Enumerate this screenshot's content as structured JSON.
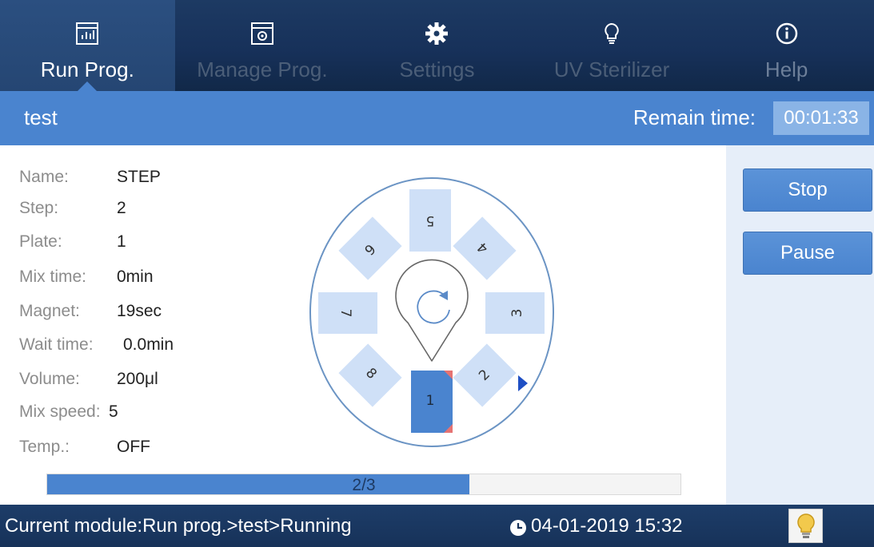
{
  "nav": {
    "tabs": [
      {
        "label": "Run Prog.",
        "icon": "chart-icon",
        "active": true
      },
      {
        "label": "Manage Prog.",
        "icon": "manage-icon",
        "active": false
      },
      {
        "label": "Settings",
        "icon": "gear-icon",
        "active": false
      },
      {
        "label": "UV Sterilizer",
        "icon": "bulb-icon",
        "active": false
      },
      {
        "label": "Help",
        "icon": "info-icon",
        "active": false
      }
    ]
  },
  "title_bar": {
    "program_name": "test",
    "remain_label": "Remain time:",
    "remain_value": "00:01:33"
  },
  "info": {
    "rows": [
      {
        "label": "Name:",
        "value": "STEP"
      },
      {
        "label": "Step:",
        "value": "2"
      },
      {
        "label": "Plate:",
        "value": "1"
      },
      {
        "label": "Mix time:",
        "value": "0min"
      },
      {
        "label": "Magnet:",
        "value": "19sec"
      },
      {
        "label": "Wait time:",
        "value": "0.0min"
      },
      {
        "label": "Volume:",
        "value": "200μl"
      },
      {
        "label": "Mix speed:",
        "value": "5"
      },
      {
        "label": "Temp.:",
        "value": "OFF"
      }
    ]
  },
  "plate": {
    "positions": [
      "1",
      "2",
      "3",
      "4",
      "5",
      "6",
      "7",
      "8"
    ],
    "active_position": "1",
    "center_icon": "rotate-icon",
    "indicator_icon": "play-marker-icon"
  },
  "actions": {
    "stop_label": "Stop",
    "pause_label": "Pause"
  },
  "progress": {
    "text": "2/3",
    "fraction": 0.667
  },
  "status_bar": {
    "module": "Current module:Run prog.>test>Running",
    "datetime": "04-01-2019 15:32",
    "clock_icon": "clock-icon",
    "bulb_icon": "bulb-icon"
  },
  "colors": {
    "nav_bg": "#1d3a63",
    "accent": "#4a84cf",
    "remain_box": "#8ab4e6",
    "tile": "#cfe0f7",
    "active_tile": "#4a84cf",
    "corner_mark": "#e57373",
    "panel_bg": "#e6eef9"
  }
}
